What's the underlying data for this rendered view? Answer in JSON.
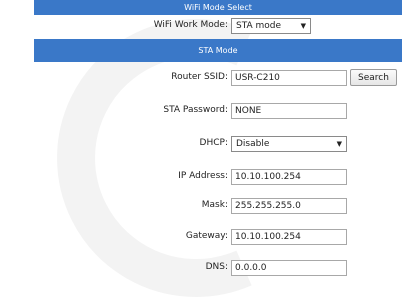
{
  "wifi_mode_section": {
    "title": "WiFi Mode Select",
    "work_mode_label": "WiFi Work Mode:",
    "work_mode_value": "STA mode"
  },
  "sta_section": {
    "title": "STA Mode",
    "router_ssid_label": "Router SSID:",
    "router_ssid_value": "USR-C210",
    "search_button_label": "Search",
    "sta_password_label": "STA Password:",
    "sta_password_value": "NONE",
    "dhcp_label": "DHCP:",
    "dhcp_value": "Disable",
    "ip_address_label": "IP Address:",
    "ip_address_value": "10.10.100.254",
    "mask_label": "Mask:",
    "mask_value": "255.255.255.0",
    "gateway_label": "Gateway:",
    "gateway_value": "10.10.100.254",
    "dns_label": "DNS:",
    "dns_value": "0.0.0.0"
  },
  "icons": {
    "select_caret": "triangle-down"
  },
  "colors": {
    "header_bar": "#3a78c8",
    "watermark": "#f3f3f3"
  }
}
